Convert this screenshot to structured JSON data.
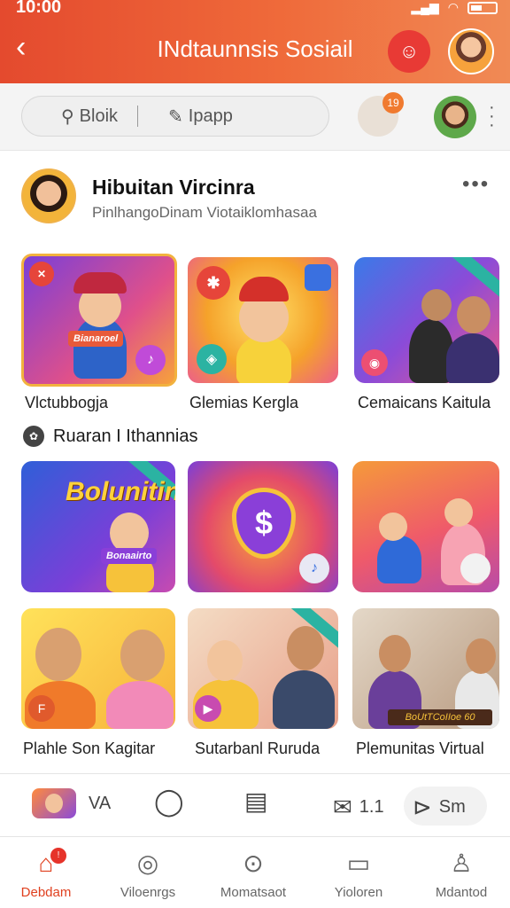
{
  "status_bar": {
    "time": "10:00"
  },
  "header": {
    "title": "INdtaunnsis Sosiail",
    "back_icon": "chevron-left-icon",
    "chat_icon": "smiley-chat-icon"
  },
  "search": {
    "left_text": "Bloik",
    "right_text": "Ipapp",
    "notification_count": "19"
  },
  "profile": {
    "name": "Hibuitan Vircinra",
    "subtitle": "PinlhangoDinam Viotaiklomhasaa",
    "more": "•••"
  },
  "row1": [
    {
      "caption": "Vlctubbogja",
      "overlay": "Bianaroel"
    },
    {
      "caption": "Glemias Kergla"
    },
    {
      "caption": "Cemaicans Kaitula"
    }
  ],
  "section": {
    "title": "Ruaran I Ithannias"
  },
  "row2": [
    {
      "overlay": "Bolunitin",
      "plaque": "Bonaairto"
    },
    {
      "symbol": "$"
    },
    {
      "symbol": ""
    }
  ],
  "row3": [
    {
      "caption": "Plahle Son Kagitar",
      "badge": "F"
    },
    {
      "caption": "Sutarbanl Ruruda"
    },
    {
      "caption": "Plemunitas Virtual",
      "strip": "BoUtTCoIIoe 60"
    }
  ],
  "actionbar": {
    "count1": "VA",
    "count2": "1.1",
    "count3": "Sm"
  },
  "nav": [
    {
      "label": "Debdam",
      "icon": "home-icon",
      "badge": "!"
    },
    {
      "label": "Viloenrgs",
      "icon": "chat-bubble-icon"
    },
    {
      "label": "Momatsaot",
      "icon": "search-bubble-icon"
    },
    {
      "label": "Yioloren",
      "icon": "book-icon"
    },
    {
      "label": "Mdantod",
      "icon": "user-icon"
    }
  ],
  "colors": {
    "header_start": "#e44a2e",
    "header_end": "#f08a55",
    "active_nav": "#e0401f"
  }
}
